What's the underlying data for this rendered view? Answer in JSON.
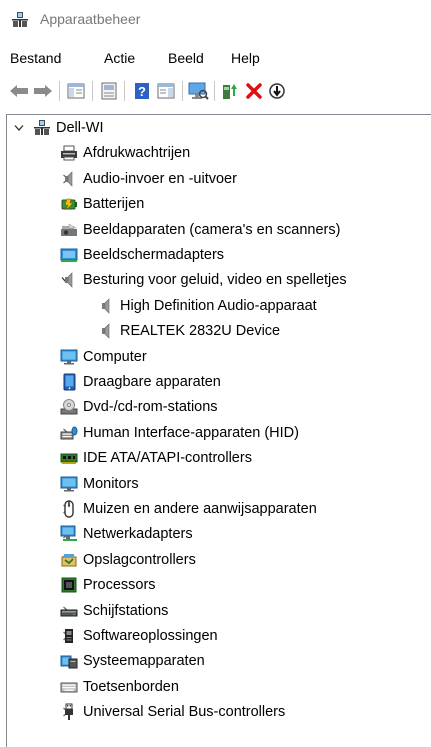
{
  "window": {
    "title": "Apparaatbeheer"
  },
  "menu": [
    "Bestand",
    "Actie",
    "Beeld",
    "Help"
  ],
  "toolbar": [
    {
      "name": "back-icon"
    },
    {
      "name": "forward-icon"
    },
    {
      "name": "show-hide-console-tree-icon"
    },
    {
      "name": "properties-icon"
    },
    {
      "name": "help-icon"
    },
    {
      "name": "action-pane-icon"
    },
    {
      "name": "scan-hardware-icon"
    },
    {
      "name": "update-driver-icon"
    },
    {
      "name": "uninstall-device-icon"
    },
    {
      "name": "disable-device-icon"
    }
  ],
  "tree": {
    "root": "Dell-WI",
    "categories": [
      {
        "label": "Afdrukwachtrijen",
        "icon": "printer-icon",
        "expanded": false
      },
      {
        "label": "Audio-invoer en -uitvoer",
        "icon": "speaker-icon",
        "expanded": false
      },
      {
        "label": "Batterijen",
        "icon": "battery-icon",
        "expanded": false
      },
      {
        "label": "Beeldapparaten (camera's en scanners)",
        "icon": "camera-icon",
        "expanded": false
      },
      {
        "label": "Beeldschermadapters",
        "icon": "display-adapter-icon",
        "expanded": false
      },
      {
        "label": "Besturing voor geluid, video en spelletjes",
        "icon": "speaker-icon",
        "expanded": true,
        "children": [
          {
            "label": "High Definition Audio-apparaat",
            "icon": "speaker-icon"
          },
          {
            "label": "REALTEK 2832U Device",
            "icon": "speaker-icon"
          }
        ]
      },
      {
        "label": "Computer",
        "icon": "computer-icon",
        "expanded": false
      },
      {
        "label": "Draagbare apparaten",
        "icon": "portable-device-icon",
        "expanded": false
      },
      {
        "label": "Dvd-/cd-rom-stations",
        "icon": "dvd-drive-icon",
        "expanded": false
      },
      {
        "label": "Human Interface-apparaten (HID)",
        "icon": "hid-icon",
        "expanded": false
      },
      {
        "label": "IDE ATA/ATAPI-controllers",
        "icon": "ide-controller-icon",
        "expanded": false
      },
      {
        "label": "Monitors",
        "icon": "monitor-icon",
        "expanded": false
      },
      {
        "label": "Muizen en andere aanwijsapparaten",
        "icon": "mouse-icon",
        "expanded": false
      },
      {
        "label": "Netwerkadapters",
        "icon": "network-adapter-icon",
        "expanded": false
      },
      {
        "label": "Opslagcontrollers",
        "icon": "storage-controller-icon",
        "expanded": false
      },
      {
        "label": "Processors",
        "icon": "processor-icon",
        "expanded": false
      },
      {
        "label": "Schijfstations",
        "icon": "disk-drive-icon",
        "expanded": false
      },
      {
        "label": "Softwareoplossingen",
        "icon": "software-component-icon",
        "expanded": false
      },
      {
        "label": "Systeemapparaten",
        "icon": "system-devices-icon",
        "expanded": false
      },
      {
        "label": "Toetsenborden",
        "icon": "keyboard-icon",
        "expanded": false
      },
      {
        "label": "Universal Serial Bus-controllers",
        "icon": "usb-icon",
        "expanded": false
      }
    ]
  }
}
